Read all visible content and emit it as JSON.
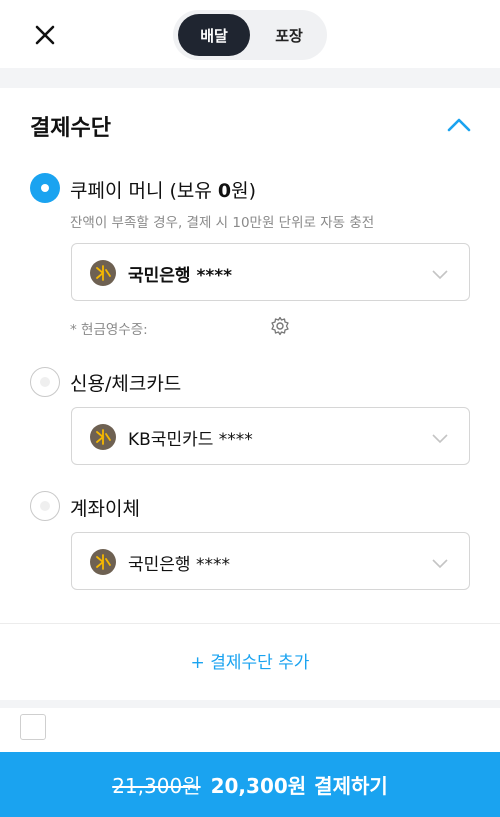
{
  "header": {
    "close_icon": "close-icon",
    "tabs": [
      {
        "label": "배달",
        "active": true
      },
      {
        "label": "포장",
        "active": false
      }
    ]
  },
  "payment": {
    "title": "결제수단",
    "collapse_icon": "chevron-up-icon",
    "options": [
      {
        "label_prefix": "쿠페이 머니 (보유 ",
        "label_amount": "0",
        "label_suffix": "원)",
        "selected": true,
        "hint": "잔액이 부족할 경우, 결제 시 10만원 단위로 자동 충전",
        "account": "국민은행 ****",
        "receipt_label": "* 현금영수증:"
      },
      {
        "label": "신용/체크카드",
        "selected": false,
        "account": "KB국민카드 ****"
      },
      {
        "label": "계좌이체",
        "selected": false,
        "account": "국민은행 ****"
      }
    ],
    "add_method_label": "+ 결제수단 추가"
  },
  "footer": {
    "original_price": "21,300원",
    "final_price": "20,300원",
    "action_label": "결제하기"
  },
  "colors": {
    "accent": "#1aa3f0",
    "dark_toggle": "#1f2530",
    "bank_logo": "#6e6152"
  }
}
